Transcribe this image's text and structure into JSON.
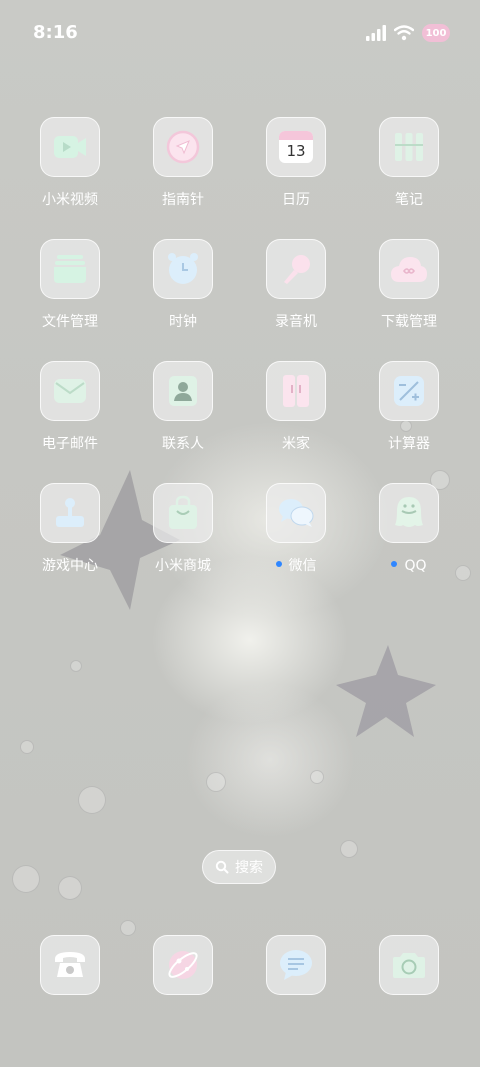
{
  "status_bar": {
    "time": "8:16",
    "battery": "100"
  },
  "apps": [
    {
      "label": "小米视频"
    },
    {
      "label": "指南针"
    },
    {
      "label": "日历",
      "calendar_day": "13"
    },
    {
      "label": "笔记"
    },
    {
      "label": "文件管理"
    },
    {
      "label": "时钟"
    },
    {
      "label": "录音机"
    },
    {
      "label": "下载管理"
    },
    {
      "label": "电子邮件"
    },
    {
      "label": "联系人"
    },
    {
      "label": "米家"
    },
    {
      "label": "计算器"
    },
    {
      "label": "游戏中心"
    },
    {
      "label": "小米商城"
    },
    {
      "label": "微信",
      "badge": true
    },
    {
      "label": "QQ",
      "badge": true
    }
  ],
  "search": {
    "label": "搜索"
  },
  "dock": [
    {
      "icon": "phone-icon"
    },
    {
      "icon": "browser-icon"
    },
    {
      "icon": "messages-icon"
    },
    {
      "icon": "camera-icon"
    }
  ],
  "colors": {
    "badge": "#2f86ff",
    "icon_tile": "#ececec"
  }
}
